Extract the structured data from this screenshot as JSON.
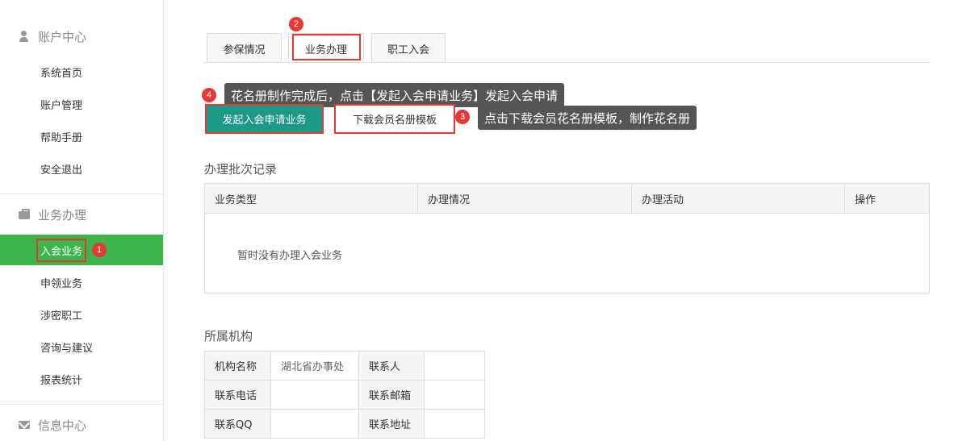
{
  "sidebar": {
    "sections": [
      {
        "title": "账户中心",
        "icon": "user-icon"
      },
      {
        "title": "业务办理",
        "icon": "briefcase-icon"
      },
      {
        "title": "信息中心",
        "icon": "mail-icon"
      }
    ],
    "account_items": [
      "系统首页",
      "账户管理",
      "帮助手册",
      "安全退出"
    ],
    "business_items": [
      "入会业务",
      "申领业务",
      "涉密职工",
      "咨询与建议",
      "报表统计"
    ],
    "active_item": "入会业务"
  },
  "tabs": [
    "参保情况",
    "业务办理",
    "职工入会"
  ],
  "selected_tab": "业务办理",
  "buttons": {
    "apply": "发起入会申请业务",
    "download": "下载会员名册模板"
  },
  "annotations": {
    "badge1": "1",
    "badge2": "2",
    "badge3": "3",
    "badge4": "4",
    "tip_apply": "花名册制作完成后，点击【发起入会申请业务】发起入会申请",
    "tip_download": "点击下载会员花名册模板，制作花名册"
  },
  "records": {
    "title": "办理批次记录",
    "columns": [
      "业务类型",
      "办理情况",
      "办理活动",
      "操作"
    ],
    "empty_text": "暂时没有办理入会业务"
  },
  "org": {
    "title": "所属机构",
    "rows": [
      {
        "label1": "机构名称",
        "value1": "湖北省办事处",
        "label2": "联系人",
        "value2": ""
      },
      {
        "label1": "联系电话",
        "value1": "",
        "label2": "联系邮箱",
        "value2": ""
      },
      {
        "label1": "联系QQ",
        "value1": "",
        "label2": "联系地址",
        "value2": ""
      }
    ]
  },
  "colors": {
    "active_green": "#3cb54a",
    "primary_teal": "#1b9a8a",
    "highlight_red": "#e53935",
    "tooltip_gray": "#555555"
  }
}
